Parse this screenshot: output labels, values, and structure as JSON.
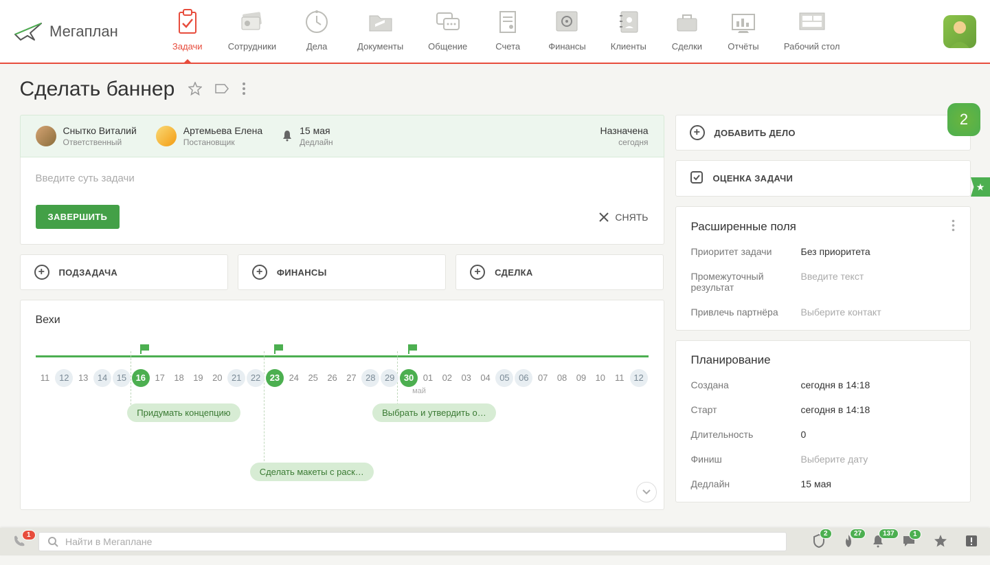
{
  "logo": {
    "text": "Мегаплан"
  },
  "nav": [
    {
      "label": "Задачи",
      "active": true
    },
    {
      "label": "Сотрудники"
    },
    {
      "label": "Дела"
    },
    {
      "label": "Документы"
    },
    {
      "label": "Общение"
    },
    {
      "label": "Счета"
    },
    {
      "label": "Финансы"
    },
    {
      "label": "Клиенты"
    },
    {
      "label": "Сделки"
    },
    {
      "label": "Отчёты"
    },
    {
      "label": "Рабочий стол"
    }
  ],
  "page": {
    "title": "Сделать баннер"
  },
  "badge_count": "2",
  "people": {
    "responsible": {
      "name": "Снытко Виталий",
      "role": "Ответственный"
    },
    "creator": {
      "name": "Артемьева Елена",
      "role": "Постановщик"
    },
    "deadline": {
      "date": "15 мая",
      "label": "Дедлайн"
    },
    "status": {
      "text": "Назначена",
      "sub": "сегодня"
    }
  },
  "task": {
    "placeholder": "Введите суть задачи",
    "complete_btn": "ЗАВЕРШИТЬ",
    "remove_btn": "СНЯТЬ"
  },
  "add_buttons": {
    "subtask": "ПОДЗАДАЧА",
    "finance": "ФИНАНСЫ",
    "deal": "СДЕЛКА"
  },
  "milestones": {
    "title": "Вехи",
    "month_label": "май",
    "days": [
      "11",
      "12",
      "13",
      "14",
      "15",
      "16",
      "17",
      "18",
      "19",
      "20",
      "21",
      "22",
      "23",
      "24",
      "25",
      "26",
      "27",
      "28",
      "29",
      "30",
      "01",
      "02",
      "03",
      "04",
      "05",
      "06",
      "07",
      "08",
      "09",
      "10",
      "11",
      "12"
    ],
    "dim": [
      "14",
      "15",
      "21",
      "22",
      "28",
      "29",
      "05",
      "06",
      "12"
    ],
    "green": [
      "16",
      "23",
      "30"
    ],
    "items": [
      {
        "label": "Придумать концепцию"
      },
      {
        "label": "Сделать макеты с раск…"
      },
      {
        "label": "Выбрать и утвердить о…"
      }
    ]
  },
  "side": {
    "add_deal": "ДОБАВИТЬ ДЕЛО",
    "eval": "ОЦЕНКА ЗАДАЧИ",
    "extended_title": "Расширенные поля",
    "fields": {
      "priority_label": "Приоритет задачи",
      "priority_val": "Без приоритета",
      "interim_label": "Промежуточный результат",
      "interim_val": "Введите текст",
      "partner_label": "Привлечь партнёра",
      "partner_val": "Выберите контакт"
    },
    "planning_title": "Планирование",
    "planning": {
      "created_label": "Создана",
      "created_val": "сегодня в 14:18",
      "start_label": "Старт",
      "start_val": "сегодня в 14:18",
      "duration_label": "Длительность",
      "duration_val": "0",
      "finish_label": "Финиш",
      "finish_val": "Выберите дату",
      "deadline_label": "Дедлайн",
      "deadline_val": "15 мая"
    }
  },
  "bottombar": {
    "call_count": "1",
    "search_placeholder": "Найти в Мегаплане",
    "b1": "2",
    "b2": "27",
    "b3": "137",
    "b4": "1"
  }
}
